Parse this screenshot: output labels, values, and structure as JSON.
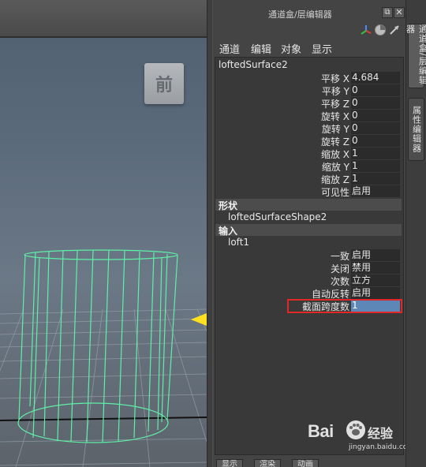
{
  "viewport": {
    "view_cube_label": "前"
  },
  "panel": {
    "title": "通道盒/层编辑器",
    "float_glyph": "⧉",
    "close_glyph": "✕",
    "menu": [
      "通道",
      "编辑",
      "对象",
      "显示"
    ],
    "node_name": "loftedSurface2",
    "attributes": [
      {
        "label": "平移 X",
        "value": "4.684"
      },
      {
        "label": "平移 Y",
        "value": "0"
      },
      {
        "label": "平移 Z",
        "value": "0"
      },
      {
        "label": "旋转 X",
        "value": "0"
      },
      {
        "label": "旋转 Y",
        "value": "0"
      },
      {
        "label": "旋转 Z",
        "value": "0"
      },
      {
        "label": "缩放 X",
        "value": "1"
      },
      {
        "label": "缩放 Y",
        "value": "1"
      },
      {
        "label": "缩放 Z",
        "value": "1"
      },
      {
        "label": "可见性",
        "value": "启用"
      }
    ],
    "shape_section": "形状",
    "shape_name": "loftedSurfaceShape2",
    "input_section": "输入",
    "input_name": "loft1",
    "input_attributes": [
      {
        "label": "一致",
        "value": "启用"
      },
      {
        "label": "关闭",
        "value": "禁用"
      },
      {
        "label": "次数",
        "value": "立方"
      },
      {
        "label": "自动反转",
        "value": "启用"
      },
      {
        "label": "截面跨度数",
        "value": "1",
        "selected": true
      }
    ],
    "bottom_tabs": [
      "显示",
      "渲染",
      "动画"
    ]
  },
  "side_tabs": [
    "通道盒/层编辑器",
    "属性编辑器"
  ],
  "watermark": {
    "logo": "Bai",
    "brand": "经验",
    "url": "jingyan.baidu.com"
  },
  "colors": {
    "wireframe": "#5ff0a8",
    "arrow": "#ffe020",
    "highlight_box": "#e0282a",
    "selected_value": "#5d87b6"
  }
}
